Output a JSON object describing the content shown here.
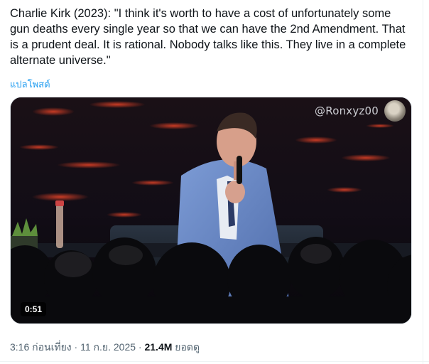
{
  "post": {
    "text": "Charlie Kirk (2023): \"I think it's worth to have a cost of unfortunately some gun deaths every single year so that we can have the 2nd Amendment. That is a prudent deal. It is rational. Nobody talks like this. They live in a complete alternate universe.\"",
    "translate_label": "แปลโพสต์"
  },
  "media": {
    "watermark": "@Ronxyz00",
    "duration": "0:51"
  },
  "meta": {
    "time": "3:16 ก่อนเที่ยง",
    "separator": "·",
    "date": "11 ก.ย. 2025",
    "views_count": "21.4M",
    "views_label": "ยอดดู"
  }
}
